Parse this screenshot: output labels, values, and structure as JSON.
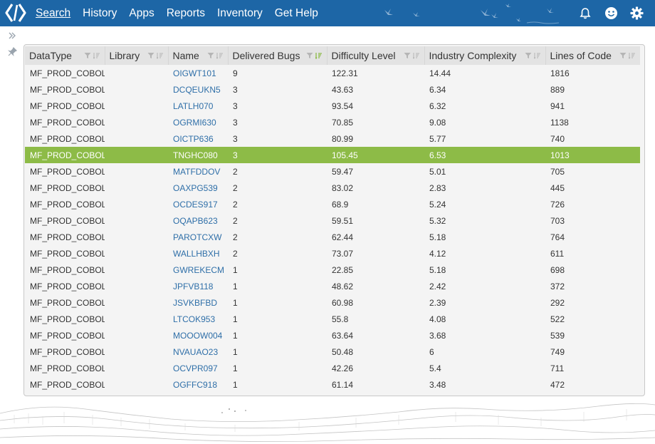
{
  "nav": {
    "items": [
      "Search",
      "History",
      "Apps",
      "Reports",
      "Inventory",
      "Get Help"
    ]
  },
  "icons": {
    "logo": "code-brackets-logo",
    "notifications": "bell-icon",
    "profile": "smiley-icon",
    "settings": "gear-icon",
    "expand": "double-chevron-right-icon",
    "pin": "pin-icon"
  },
  "colors": {
    "topbar": "#1d66a6",
    "selected_row": "#8dbb47",
    "link": "#2f6fa8",
    "sort_active": "#8dbb47"
  },
  "table": {
    "columns": [
      "DataType",
      "Library",
      "Name",
      "Delivered Bugs",
      "Difficulty Level",
      "Industry Complexity",
      "Lines of Code"
    ],
    "sorted_column": "Delivered Bugs",
    "selected_row_index": 5,
    "rows": [
      [
        "MF_PROD_COBOL",
        "",
        "OIGWT101",
        "9",
        "122.31",
        "14.44",
        "1816"
      ],
      [
        "MF_PROD_COBOL",
        "",
        "DCQEUKN5",
        "3",
        "43.63",
        "6.34",
        "889"
      ],
      [
        "MF_PROD_COBOL",
        "",
        "LATLH070",
        "3",
        "93.54",
        "6.32",
        "941"
      ],
      [
        "MF_PROD_COBOL",
        "",
        "OGRMI630",
        "3",
        "70.85",
        "9.08",
        "1138"
      ],
      [
        "MF_PROD_COBOL",
        "",
        "OICTP636",
        "3",
        "80.99",
        "5.77",
        "740"
      ],
      [
        "MF_PROD_COBOL",
        "",
        "TNGHC080",
        "3",
        "105.45",
        "6.53",
        "1013"
      ],
      [
        "MF_PROD_COBOL",
        "",
        "MATFDDOV",
        "2",
        "59.47",
        "5.01",
        "705"
      ],
      [
        "MF_PROD_COBOL",
        "",
        "OAXPG539",
        "2",
        "83.02",
        "2.83",
        "445"
      ],
      [
        "MF_PROD_COBOL",
        "",
        "OCDES917",
        "2",
        "68.9",
        "5.24",
        "726"
      ],
      [
        "MF_PROD_COBOL",
        "",
        "OQAPB623",
        "2",
        "59.51",
        "5.32",
        "703"
      ],
      [
        "MF_PROD_COBOL",
        "",
        "PAROTCXW",
        "2",
        "62.44",
        "5.18",
        "764"
      ],
      [
        "MF_PROD_COBOL",
        "",
        "WALLHBXH",
        "2",
        "73.07",
        "4.12",
        "611"
      ],
      [
        "MF_PROD_COBOL",
        "",
        "GWREKECM",
        "1",
        "22.85",
        "5.18",
        "698"
      ],
      [
        "MF_PROD_COBOL",
        "",
        "JPFVB118",
        "1",
        "48.62",
        "2.42",
        "372"
      ],
      [
        "MF_PROD_COBOL",
        "",
        "JSVKBFBD",
        "1",
        "60.98",
        "2.39",
        "292"
      ],
      [
        "MF_PROD_COBOL",
        "",
        "LTCOK953",
        "1",
        "55.8",
        "4.08",
        "522"
      ],
      [
        "MF_PROD_COBOL",
        "",
        "MOOOW004",
        "1",
        "63.64",
        "3.68",
        "539"
      ],
      [
        "MF_PROD_COBOL",
        "",
        "NVAUAO23",
        "1",
        "50.48",
        "6",
        "749"
      ],
      [
        "MF_PROD_COBOL",
        "",
        "OCVPR097",
        "1",
        "42.26",
        "5.4",
        "711"
      ],
      [
        "MF_PROD_COBOL",
        "",
        "OGFFC918",
        "1",
        "61.14",
        "3.48",
        "472"
      ]
    ]
  }
}
